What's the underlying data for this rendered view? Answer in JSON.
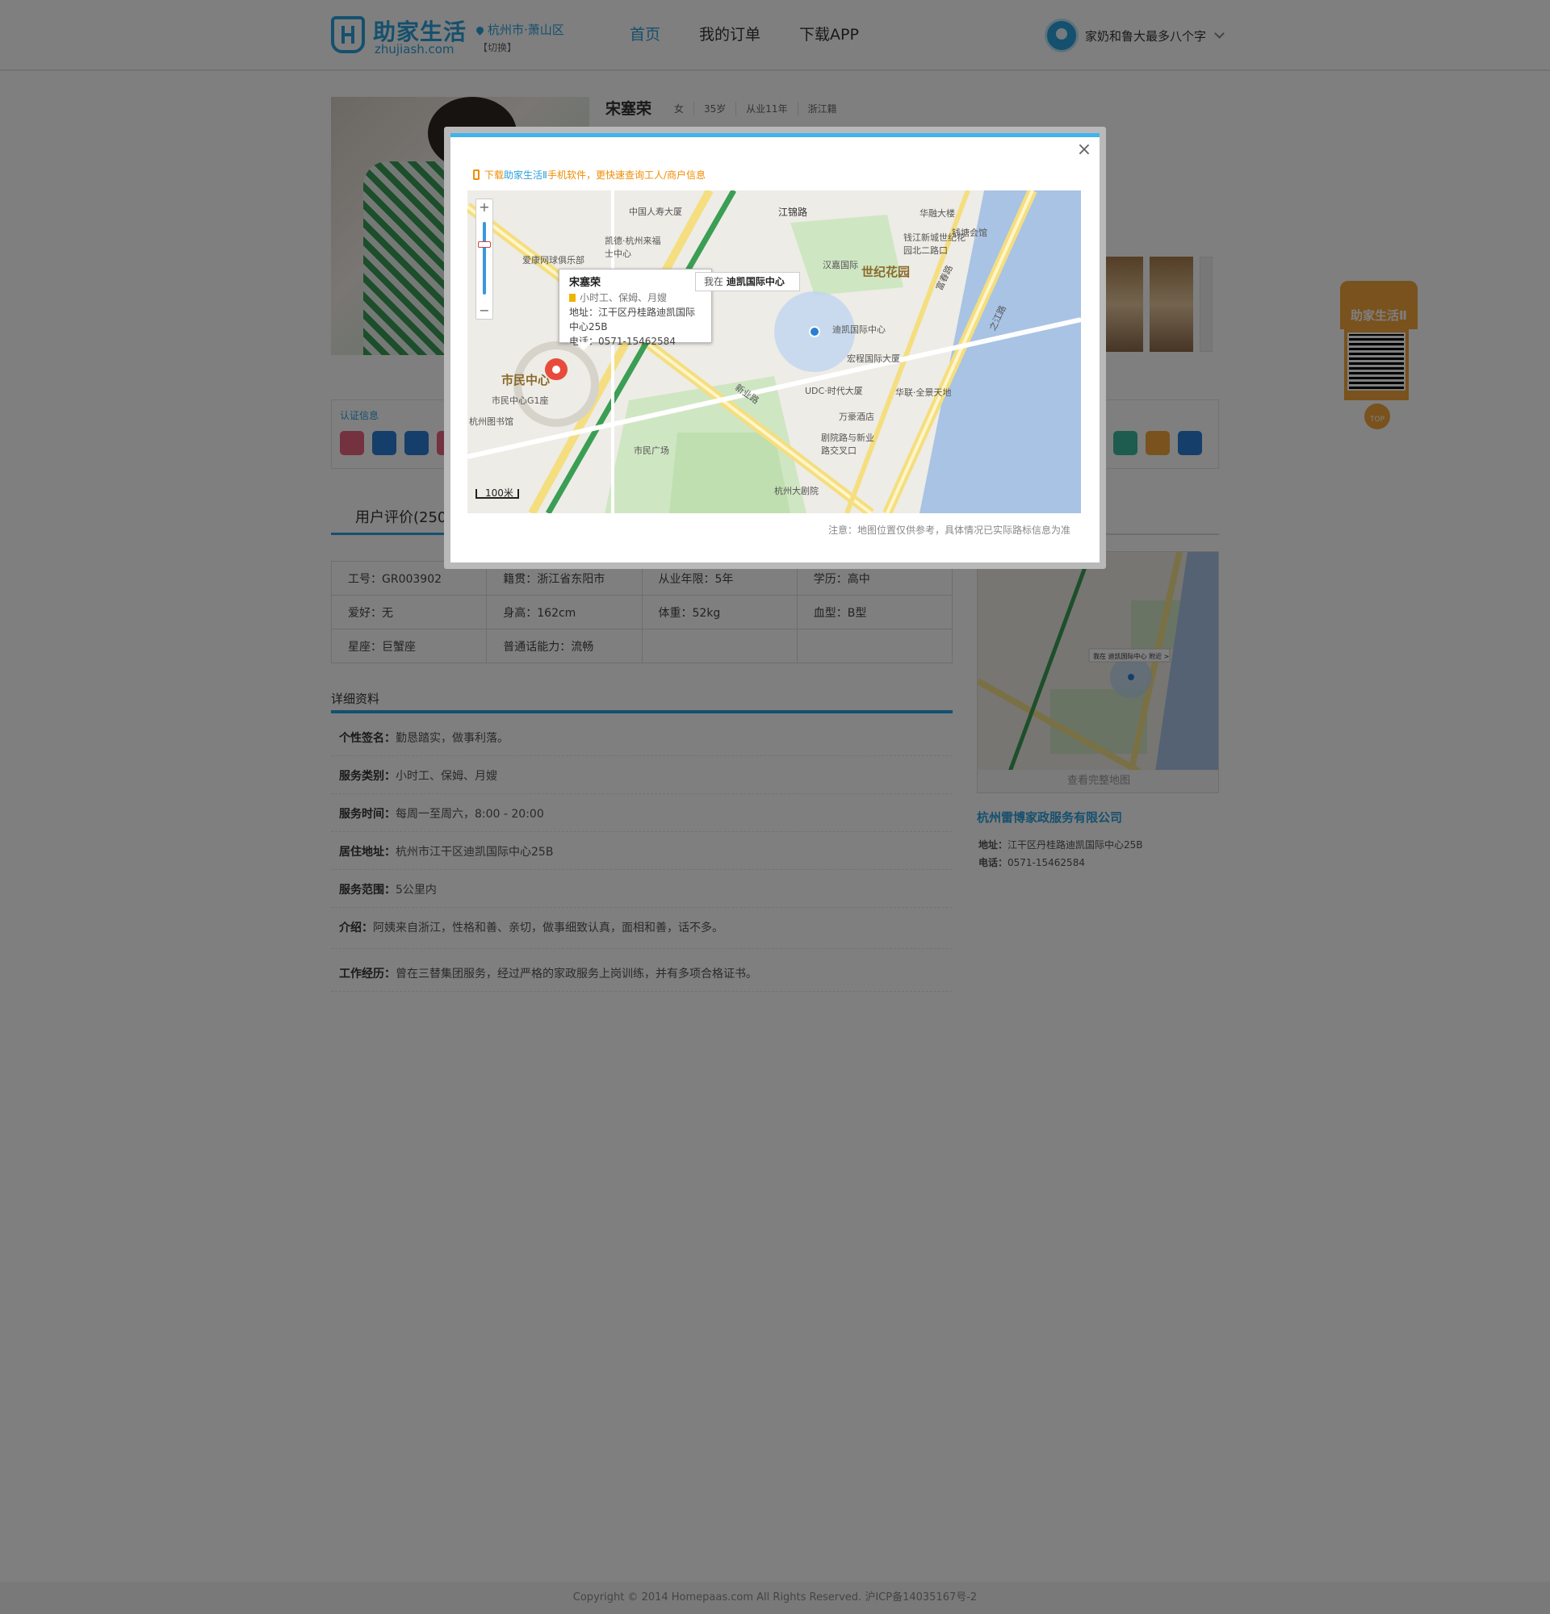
{
  "header": {
    "brand_name": "助家生活",
    "brand_domain": "zhujiash.com",
    "city": "杭州市·萧山区",
    "city_switch": "【切换】",
    "nav": [
      "首页",
      "我的订单",
      "下载APP"
    ],
    "user_name": "家奶和鲁大最多八个字"
  },
  "profile": {
    "name": "宋塞荣",
    "gender": "女",
    "age": "35岁",
    "experience": "从业11年",
    "native": "浙江籍"
  },
  "cert": {
    "title": "认证信息",
    "icon_colors": [
      "#e8637f",
      "#2a7fd4",
      "#2a7fd4",
      "#e8637f"
    ],
    "icon_colors_right": [
      "#3bb89c",
      "#f3a43a",
      "#2a7fd4"
    ]
  },
  "tabs": {
    "reviews": "用户评价(250)"
  },
  "info_table": [
    [
      "工号：GR003902",
      "籍贯：浙江省东阳市",
      "从业年限：5年",
      "学历：高中"
    ],
    [
      "爱好：无",
      "身高：162cm",
      "体重：52kg",
      "血型：B型"
    ],
    [
      "星座：巨蟹座",
      "普通话能力：流畅",
      "",
      ""
    ]
  ],
  "detail": {
    "title": "详细资料",
    "rows": [
      {
        "label": "个性签名：",
        "value": "勤恳踏实，做事利落。"
      },
      {
        "label": "服务类别：",
        "value": "小时工、保姆、月嫂"
      },
      {
        "label": "服务时间：",
        "value": "每周一至周六，8:00 - 20:00"
      },
      {
        "label": "居住地址：",
        "value": "杭州市江干区迪凯国际中心25B"
      },
      {
        "label": "服务范围：",
        "value": "5公里内"
      },
      {
        "label": "介绍：",
        "value": "阿姨来自浙江，性格和善、亲切，做事细致认真，面相和善，话不多。"
      },
      {
        "label": "工作经历：",
        "value": "曾在三替集团服务，经过严格的家政服务上岗训练，并有多项合格证书。"
      }
    ]
  },
  "minimap": {
    "view_full": "查看完整地图",
    "here_text": "我在 迪凯国际中心 附近 >"
  },
  "company": {
    "name": "杭州雷博家政服务有限公司",
    "address_label": "地址：",
    "address": "江干区丹桂路迪凯国际中心25B",
    "phone_label": "电话：",
    "phone": "0571-15462584"
  },
  "qr_float": {
    "title": "助家生活Ⅱ",
    "top_label": "TOP"
  },
  "footer": {
    "copyright": "Copyright © 2014 Homepaas.com  All Rights Reserved. 沪ICP备14035167号-2"
  },
  "modal": {
    "close": "×",
    "promo_pre": "下载",
    "promo_brand": "助家生活Ⅱ",
    "promo_post": "手机软件，更快速查询工人/商户信息",
    "popup_name": "宋塞荣",
    "popup_tags": "小时工、保姆、月嫂",
    "popup_address": "地址：江干区丹桂路迪凯国际中心25B",
    "popup_phone": "电话：0571-15462584",
    "here_prefix": "我在",
    "here_place": "迪凯国际中心",
    "scale": "100米",
    "note": "注意：地图位置仅供参考，具体情况已实际路标信息为准",
    "map_labels": [
      "中国人寿大厦",
      "江锦路",
      "华融大楼",
      "钱塘会馆",
      "凯德·杭州来福士中心",
      "钱江新城世纪花园北二路口",
      "爱康网球俱乐部",
      "汉嘉国际",
      "世纪花园",
      "迪凯国际中心",
      "宏程国际大厦",
      "UDC·时代大厦",
      "华联·全景天地",
      "万豪酒店",
      "剧院路与新业路交叉口",
      "市民中心",
      "市民中心G1座",
      "市民广场",
      "杭州大剧院",
      "新业路",
      "之江路",
      "富春路",
      "杭州图书馆"
    ]
  }
}
